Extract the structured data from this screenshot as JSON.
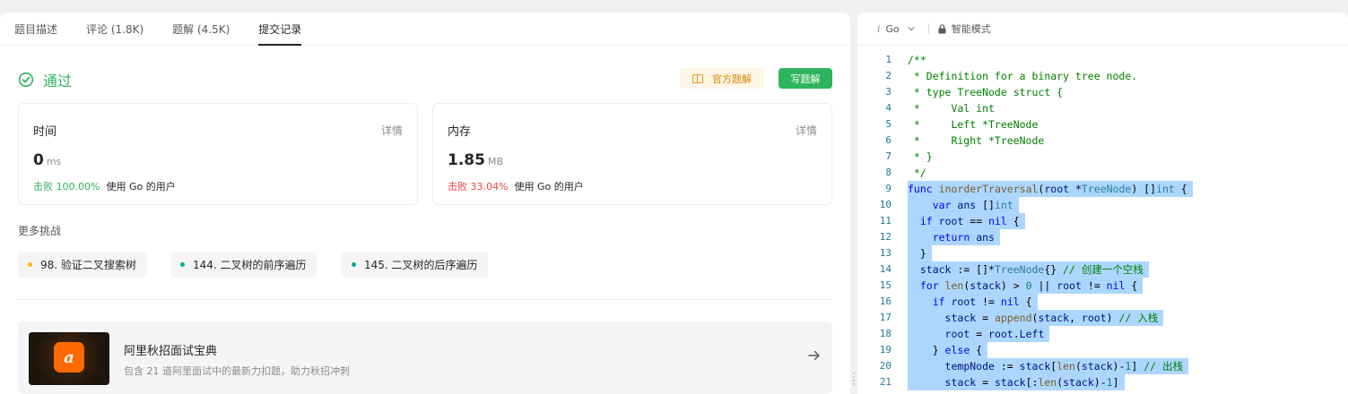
{
  "tabs": [
    {
      "label": "题目描述"
    },
    {
      "label": "评论 (1.8K)"
    },
    {
      "label": "题解 (4.5K)"
    },
    {
      "label": "提交记录"
    }
  ],
  "status": {
    "text": "通过",
    "color": "#2db55d"
  },
  "buttons": {
    "official": "官方题解",
    "write": "写题解"
  },
  "time_card": {
    "label": "时间",
    "detail": "详情",
    "value": "0",
    "unit": "ms",
    "beat_prefix": "击败 100.00%",
    "beat_suffix": "使用 Go 的用户"
  },
  "memory_card": {
    "label": "内存",
    "detail": "详情",
    "value": "1.85",
    "unit": "MB",
    "beat_prefix": "击败 33.04%",
    "beat_suffix": "使用 Go 的用户"
  },
  "more_challenges": {
    "title": "更多挑战",
    "items": [
      {
        "label": "98. 验证二叉搜索树",
        "dot_color": "#ffb800"
      },
      {
        "label": "144. 二叉树的前序遍历",
        "dot_color": "#00af9b"
      },
      {
        "label": "145. 二叉树的后序遍历",
        "dot_color": "#00af9b"
      }
    ]
  },
  "promo": {
    "logo_text": "a",
    "title": "阿里秋招面试宝典",
    "subtitle": "包含 21 道阿里面试中的最新力扣题，助力秋招冲刺"
  },
  "editor": {
    "language": "Go",
    "language_icon": "i",
    "mode": "智能模式",
    "code_lines": [
      {
        "num": "1",
        "html": "<span class='c'>/**</span>",
        "sel": 0
      },
      {
        "num": "2",
        "html": "<span class='c'> * Definition for a binary tree node.</span>",
        "sel": 0
      },
      {
        "num": "3",
        "html": "<span class='c'> * type TreeNode struct {</span>",
        "sel": 0
      },
      {
        "num": "4",
        "html": "<span class='c'> *     Val int</span>",
        "sel": 0
      },
      {
        "num": "5",
        "html": "<span class='c'> *     Left *TreeNode</span>",
        "sel": 0
      },
      {
        "num": "6",
        "html": "<span class='c'> *     Right *TreeNode</span>",
        "sel": 0
      },
      {
        "num": "7",
        "html": "<span class='c'> * }</span>",
        "sel": 0
      },
      {
        "num": "8",
        "html": "<span class='c'> */</span>",
        "sel": 0
      },
      {
        "num": "9",
        "html": "<span class='k'>func</span> <span class='f'>inorderTraversal</span>(<span class='v'>root</span> *<span class='t'>TreeNode</span>) []<span class='t'>int</span> {",
        "sel": 1
      },
      {
        "num": "10",
        "html": "    <span class='k'>var</span> <span class='v'>ans</span> []<span class='t'>int</span>",
        "sel": 1
      },
      {
        "num": "11",
        "html": "  <span class='k'>if</span> <span class='v'>root</span> == <span class='k'>nil</span> {",
        "sel": 1
      },
      {
        "num": "12",
        "html": "    <span class='k'>return</span> <span class='v'>ans</span>",
        "sel": 1
      },
      {
        "num": "13",
        "html": "  }",
        "sel": 1
      },
      {
        "num": "14",
        "html": "  <span class='v'>stack</span> := []*<span class='t'>TreeNode</span>{} <span class='c'>// 创建一个空栈</span>",
        "sel": 1
      },
      {
        "num": "15",
        "html": "  <span class='k'>for</span> <span class='f'>len</span>(<span class='v'>stack</span>) > <span class='n'>0</span> || <span class='v'>root</span> != <span class='k'>nil</span> {",
        "sel": 1
      },
      {
        "num": "16",
        "html": "    <span class='k'>if</span> <span class='v'>root</span> != <span class='k'>nil</span> {",
        "sel": 1
      },
      {
        "num": "17",
        "html": "      <span class='v'>stack</span> = <span class='f'>append</span>(<span class='v'>stack</span>, <span class='v'>root</span>) <span class='c'>// 入栈</span>",
        "sel": 1
      },
      {
        "num": "18",
        "html": "      <span class='v'>root</span> = <span class='v'>root</span>.<span class='v'>Left</span>",
        "sel": 1
      },
      {
        "num": "19",
        "html": "    } <span class='k'>else</span> {",
        "sel": 1
      },
      {
        "num": "20",
        "html": "      <span class='v'>tempNode</span> := <span class='v'>stack</span>[<span class='f'>len</span>(<span class='v'>stack</span>)-<span class='n'>1</span>] <span class='c'>// 出栈</span>",
        "sel": 1
      },
      {
        "num": "21",
        "html": "      <span class='v'>stack</span> = <span class='v'>stack</span>[:<span class='f'>len</span>(<span class='v'>stack</span>)-<span class='n'>1</span>]",
        "sel": 1
      }
    ]
  }
}
